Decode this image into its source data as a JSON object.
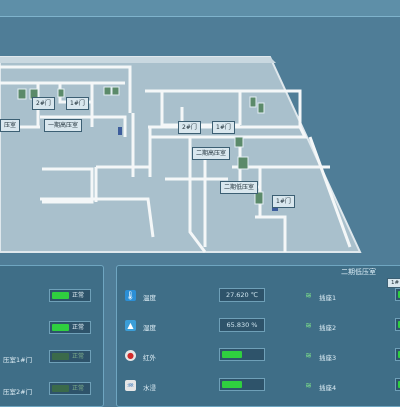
{
  "map": {
    "labels": [
      {
        "id": "door-2-left",
        "text": "2#门"
      },
      {
        "id": "door-1-left",
        "text": "1#门"
      },
      {
        "id": "room-left",
        "text": "压室"
      },
      {
        "id": "room-phase1",
        "text": "一期高压室"
      },
      {
        "id": "door-2-right",
        "text": "2#门"
      },
      {
        "id": "door-1-right",
        "text": "1#门"
      },
      {
        "id": "room-phase2-high",
        "text": "二期高压室"
      },
      {
        "id": "room-phase2-low",
        "text": "二期低压室"
      },
      {
        "id": "door-1-bottom",
        "text": "1#门"
      }
    ]
  },
  "left_panel": {
    "rows": [
      {
        "label": "",
        "status": "正常",
        "active": true
      },
      {
        "label": "",
        "status": "正常",
        "active": true
      },
      {
        "label": "压室1#门",
        "status": "正常",
        "active": false
      },
      {
        "label": "压室2#门",
        "status": "正常",
        "active": false
      }
    ]
  },
  "right_panel": {
    "title": "二期低压室",
    "sensors": [
      {
        "icon": "thermometer-icon",
        "label": "温度",
        "value": "27.620 ℃"
      },
      {
        "icon": "humidity-icon",
        "label": "湿度",
        "value": "65.830 %"
      },
      {
        "icon": "infrared-icon",
        "label": "红外",
        "value": ""
      },
      {
        "icon": "water-leak-icon",
        "label": "水浸",
        "value": ""
      }
    ],
    "outlets": [
      {
        "label": "插座1"
      },
      {
        "label": "插座2"
      },
      {
        "label": "插座3"
      },
      {
        "label": "插座4"
      }
    ],
    "edge_tag": "1#"
  }
}
